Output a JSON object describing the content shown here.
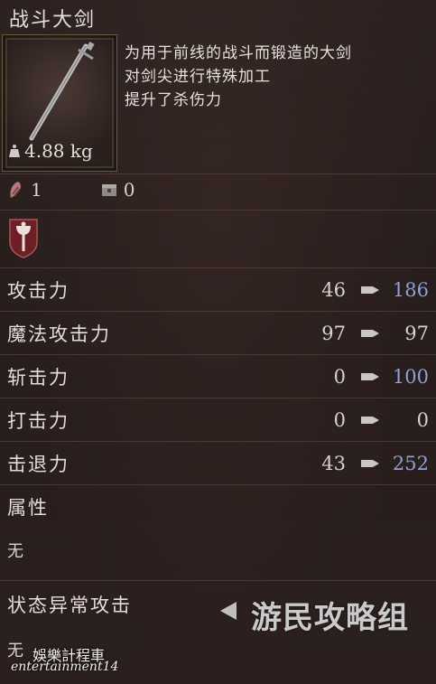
{
  "item": {
    "name": "战斗大剑",
    "weight": "4.88 kg",
    "description": [
      "为用于前线的战斗而锻造的大剑",
      "对剑尖进行特殊加工",
      "提升了杀伤力"
    ]
  },
  "upgrades": [
    {
      "icon": "upgrade-material-icon",
      "value": "1"
    },
    {
      "icon": "chest-icon",
      "value": "0"
    }
  ],
  "emblem_icon": "axe-shield-emblem-icon",
  "stats": [
    {
      "label": "攻击力",
      "current": "46",
      "new": "186",
      "improved": true
    },
    {
      "label": "魔法攻击力",
      "current": "97",
      "new": "97",
      "improved": false
    },
    {
      "label": "斩击力",
      "current": "0",
      "new": "100",
      "improved": true
    },
    {
      "label": "打击力",
      "current": "0",
      "new": "0",
      "improved": false
    },
    {
      "label": "击退力",
      "current": "43",
      "new": "252",
      "improved": true
    }
  ],
  "attribute": {
    "label": "属性",
    "value": "无"
  },
  "status": {
    "label": "状态异常攻击",
    "value": "无"
  },
  "watermark": "游民攻略组",
  "signature": {
    "line1": "娛樂計程車",
    "line2": "entertainment14"
  },
  "colors": {
    "improved": "#8ea0d8",
    "background": "#2a1f1d",
    "text": "#d9d4cf"
  }
}
